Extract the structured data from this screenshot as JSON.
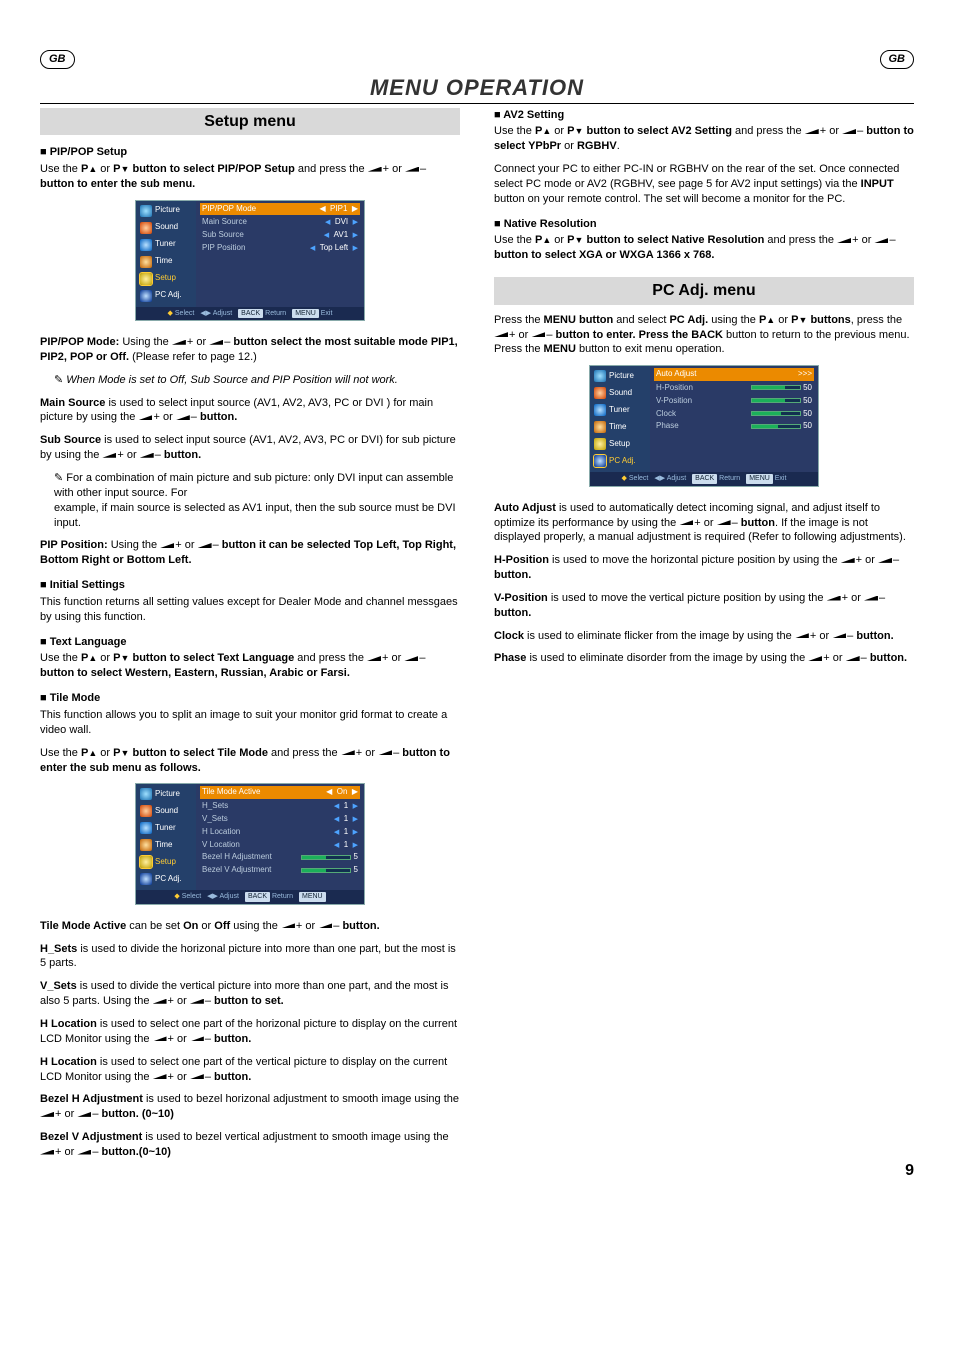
{
  "header": {
    "gb": "GB",
    "title": "MENU OPERATION"
  },
  "left": {
    "setup_banner": "Setup menu",
    "pippop_head": "PIP/POP Setup",
    "pippop_line1a": "Use the  ",
    "pippop_line1b": " button to select ",
    "pippop_line1c": "PIP/POP Setup",
    "pippop_line1d": " and press  the ",
    "pippop_line1e": " button to enter the sub menu.",
    "osd1": {
      "tabs": [
        "Picture",
        "Sound",
        "Tuner",
        "Time",
        "Setup",
        "PC Adj."
      ],
      "headrow": {
        "label": "PIP/POP Mode",
        "val": "PIP1"
      },
      "rows": [
        {
          "label": "Main Source",
          "val": "DVI"
        },
        {
          "label": "Sub  Source",
          "val": "AV1"
        },
        {
          "label": "PIP Position",
          "val": "Top Left"
        }
      ],
      "footer": {
        "select": "Select",
        "adjust": "Adjust",
        "back": "BACK",
        "ret": "Return",
        "menu": "MENU",
        "exit": "Exit"
      }
    },
    "pipmode_lead": "PIP/POP Mode:",
    "pipmode_text_a": "  Using the ",
    "pipmode_text_b": " button select the most suitable mode ",
    "pipmode_opts": "PIP1, PIP2, POP or Off.",
    "pipmode_text_c": " (Please refer to page 12.)",
    "pipmode_note": "When Mode is set to Off, Sub Source and PIP Position will not work.",
    "mainsrc_lead": "Main Source",
    "mainsrc_text": " is used to select input source (AV1, AV2, AV3, PC or DVI ) for main picture by using the ",
    "mainsrc_end": " button.",
    "subsrc_lead": "Sub Source",
    "subsrc_text": " is used to select input source (AV1, AV2, AV3, PC or DVI) for sub picture by using the ",
    "subsrc_end": " button.",
    "subsrc_note": "For a combination of main picture and sub picture: only DVI input can assemble with other input source. For\nexample, if main source is selected as AV1 input, then the sub source must be DVI input.",
    "pippos_lead": "PIP Position:",
    "pippos_text_a": "  Using the ",
    "pippos_text_b": " button it can be selected ",
    "pippos_opts": "Top Left, Top Right, Bottom Right or Bottom Left.",
    "initset_head": "Initial Settings",
    "initset_text": " This function returns all setting values except for Dealer Mode and channel messgaes by using this function.",
    "textlang_head": "Text Language",
    "textlang_a": "Use the  ",
    "textlang_b": " button to select ",
    "textlang_c": "Text Language",
    "textlang_d": " and press  the ",
    "textlang_e": " button to select Western, Eastern, Russian, Arabic or Farsi.",
    "tilemode_head": "Tile Mode",
    "tile_intro": "This function allows you to split an image to suit your monitor grid format to create a video wall.",
    "tile_a": "Use the ",
    "tile_b": " button to select ",
    "tile_c": "Tile Mode",
    "tile_d": " and press the ",
    "tile_e": " button to enter the sub menu as follows.",
    "osd2": {
      "headrow": {
        "label": "Tile Mode Active",
        "val": "On"
      },
      "rows": [
        {
          "label": "H_Sets",
          "val": "1"
        },
        {
          "label": "V_Sets",
          "val": "1"
        },
        {
          "label": "H Location",
          "val": "1"
        },
        {
          "label": "V Location",
          "val": "1"
        },
        {
          "label": "Bezel H Adjustment",
          "bar": 50,
          "num": "5"
        },
        {
          "label": "Bezel V Adjustment",
          "bar": 50,
          "num": "5"
        }
      ]
    },
    "tma_lead": "Tile Mode Active",
    "tma_text_a": " can be set ",
    "tma_on": "On",
    "tma_or": " or ",
    "tma_off": "Off",
    "tma_text_b": " using the ",
    "tma_end": "button.",
    "hsets_lead": "H_Sets",
    "hsets_text": " is used to divide the horizonal picture into more than one part, but the most is 5 parts.",
    "vsets_lead": "V_Sets",
    "vsets_text": " is used to divide the vertical picture into more than one part, and the most is also 5 parts. Using the ",
    "vsets_end": " button to set.",
    "hloc_lead": "H Location",
    "hloc_text": " is used to select one part of the horizonal picture to display on the current LCD Monitor using the ",
    "hloc_end": " button.",
    "vloc_lead": "H Location",
    "vloc_text": " is used to select one part of the vertical picture to display on the current LCD Monitor using the ",
    "vloc_end": " button.",
    "bezh_lead": "Bezel H Adjustment",
    "bezh_text": " is used to bezel horizonal adjustment to smooth image using the ",
    "bezh_end": " button. (0~10)",
    "bezv_lead": "Bezel V Adjustment",
    "bezv_text": " is used to bezel vertical adjustment to smooth image using the ",
    "bezv_end": " button.(0~10)"
  },
  "right": {
    "av2_head": "AV2 Setting",
    "av2_a": "Use the  ",
    "av2_b": " button to select ",
    "av2_c": "AV2 Setting",
    "av2_d": " and press  the ",
    "av2_e": " button to select ",
    "av2_f": "YPbPr",
    "av2_g": " or ",
    "av2_h": "RGBHV",
    "av2_i": ".",
    "av2_para": "Connect your PC to either PC-IN or RGBHV on the rear of the set. Once connected select PC mode or AV2 (RGBHV, see page 5 for AV2 input settings) via the ",
    "av2_input": "INPUT",
    "av2_para2": " button on your remote control. The set will become a monitor for the PC.",
    "native_head": "Native Resolution",
    "native_a": "Use the  ",
    "native_b": " button to select ",
    "native_c": "Native Resolution",
    "native_d": " and press the ",
    "native_e": " button to select ",
    "native_f": "XGA or WXGA  1366 x 768.",
    "pcadj_banner": "PC Adj. menu",
    "pcadj_intro_a": "Press the ",
    "pcadj_intro_b": "MENU button",
    "pcadj_intro_c": " and select ",
    "pcadj_intro_d": "PC Adj.",
    "pcadj_intro_e": " using the  ",
    "pcadj_intro_f": "buttons",
    "pcadj_intro_g": ", press the ",
    "pcadj_intro_h": " button to enter. Press the ",
    "pcadj_intro_i": "BACK",
    "pcadj_intro_j": " button to return to the previous menu. Press the ",
    "pcadj_intro_k": "MENU",
    "pcadj_intro_l": " button to exit menu operation.",
    "osd3": {
      "headrow": {
        "label": "Auto Adjust",
        "val": ">>>"
      },
      "rows": [
        {
          "label": "H-Position",
          "bar": 70,
          "num": "50"
        },
        {
          "label": "V-Position",
          "bar": 70,
          "num": "50"
        },
        {
          "label": "Clock",
          "bar": 60,
          "num": "50"
        },
        {
          "label": "Phase",
          "bar": 55,
          "num": "50"
        }
      ]
    },
    "auto_lead": "Auto Adjust",
    "auto_text": " is used to automatically detect incoming signal, and  adjust itself to optimize its performance by using the ",
    "auto_mid": "button",
    "auto_text2": ". If the image is not displayed properly, a manual adjustment is required (Refer to following adjustments).",
    "hpos_lead": "H-Position",
    "hpos_text": " is used to move the horizontal picture position by using the ",
    "hpos_end": " button.",
    "vpos_lead": "V-Position",
    "vpos_text": " is used to move the vertical picture position by using the ",
    "vpos_end": " button.",
    "clock_lead": "Clock",
    "clock_text": " is used to eliminate flicker from the image by using the ",
    "clock_end": " button.",
    "phase_lead": "Phase",
    "phase_text": " is used to eliminate disorder from the image by using the ",
    "phase_end": " button."
  },
  "page_num": "9",
  "glyph": {
    "P": "P",
    "plus": "+",
    "minus": "–",
    "or": " or "
  }
}
